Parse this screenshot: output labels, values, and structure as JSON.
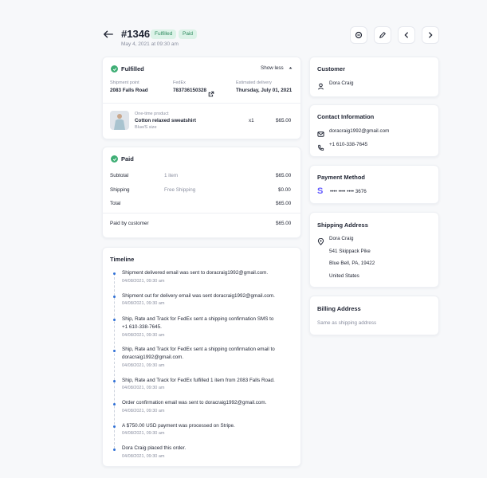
{
  "header": {
    "order_number": "#1346",
    "badge_fulfilled": "Fulfilled",
    "badge_paid": "Paid",
    "date": "May 4, 2021 at 09:30 am"
  },
  "fulfilled_card": {
    "title": "Fulfilled",
    "toggle_label": "Show less",
    "shipment_point_label": "Shipment point",
    "shipment_point_value": "2083 Falls Road",
    "carrier_label": "FedEx",
    "tracking_number": "783736150328",
    "estimated_label": "Estimated delivery",
    "estimated_value": "Thursday, July 01, 2021",
    "product": {
      "type": "One-time product",
      "name": "Cotton relaxed sweatshirt",
      "variant": "Blue/S size",
      "qty": "x1",
      "price": "$65.00"
    }
  },
  "paid_card": {
    "title": "Paid",
    "rows": [
      {
        "label": "Subtotal",
        "detail": "1 item",
        "amount": "$65.00"
      },
      {
        "label": "Shipping",
        "detail": "Free Shipping",
        "amount": "$0.00"
      },
      {
        "label": "Total",
        "detail": "",
        "amount": "$65.00"
      }
    ],
    "paid_by_label": "Paid by customer",
    "paid_by_amount": "$65.00"
  },
  "timeline": {
    "title": "Timeline",
    "events": [
      {
        "text": "Shipment delivered email was sent to doracraig1992@gmail.com.",
        "text2": "",
        "time": "04/08/2021, 09:30 am"
      },
      {
        "text": "Shipment out for delivery email was sent doracraig1992@gmail.com.",
        "text2": "",
        "time": "04/08/2021, 09:30 am"
      },
      {
        "text": "Ship, Rate and Track for FedEx sent a shipping confirmation SMS to",
        "text2": "+1 610-338-7645.",
        "time": "04/08/2021, 09:30 am"
      },
      {
        "text": "Ship, Rate and Track for FedEx sent a shipping confirmation email to",
        "text2": "doracraig1992@gmail.com.",
        "time": "04/08/2021, 09:30 am"
      },
      {
        "text": "Ship, Rate and Track for FedEx fulfilled 1 item from 2083 Falls Road.",
        "text2": "",
        "time": "04/08/2021, 09:30 am"
      },
      {
        "text": "Order confirmation email was sent to doracraig1992@gmail.com.",
        "text2": "",
        "time": "04/08/2021, 09:30 am"
      },
      {
        "text": "A $750.00 USD payment was processed on Stripe.",
        "text2": "",
        "time": "04/08/2021, 09:30 am"
      },
      {
        "text": "Dora Craig placed this order.",
        "text2": "",
        "time": "04/08/2021, 09:30 am"
      }
    ]
  },
  "customer": {
    "title": "Customer",
    "name": "Dora Craig"
  },
  "contact": {
    "title": "Contact Information",
    "email": "doracraig1992@gmail.com",
    "phone": "+1 610-338-7645"
  },
  "payment": {
    "title": "Payment Method",
    "card_masked": "•••• •••• •••• 3676",
    "brand_letter": "S"
  },
  "shipping": {
    "title": "Shipping Address",
    "line1": "Dora Craig",
    "line2": "541 Skippack Pike",
    "line3": "Blue Bell, PA, 19422",
    "line4": "United States"
  },
  "billing": {
    "title": "Billing Address",
    "text": "Same as shipping address"
  },
  "colors": {
    "accent_green": "#3fae75",
    "badge_bg": "#dcf3e8",
    "timeline_dot": "#2f6fd6",
    "stripe_blue": "#635bff"
  }
}
